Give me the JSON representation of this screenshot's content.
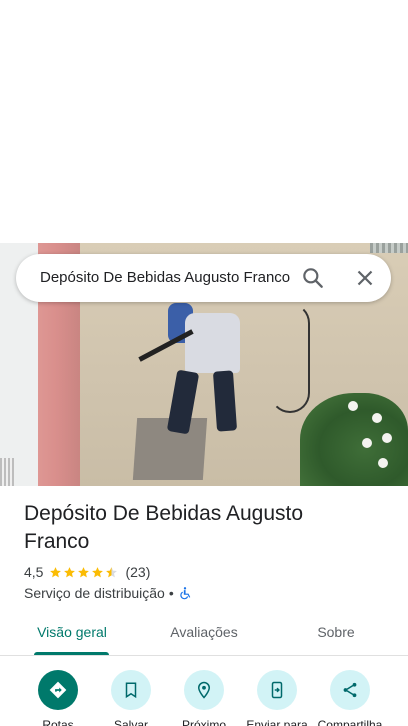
{
  "search": {
    "query": "Depósito De Bebidas Augusto Franco"
  },
  "place": {
    "title": "Depósito De Bebidas Augusto Franco",
    "rating_value": "4,5",
    "rating_stars": 4.5,
    "review_count": "(23)",
    "category": "Serviço de distribuição",
    "separator": "•"
  },
  "tabs": [
    {
      "label": "Visão geral",
      "active": true
    },
    {
      "label": "Avaliações",
      "active": false
    },
    {
      "label": "Sobre",
      "active": false
    }
  ],
  "actions": [
    {
      "label": "Rotas",
      "icon": "directions-icon"
    },
    {
      "label": "Salvar",
      "icon": "bookmark-icon"
    },
    {
      "label": "Próximo",
      "icon": "nearby-icon"
    },
    {
      "label": "Enviar para",
      "icon": "send-to-phone-icon"
    },
    {
      "label": "Compartilha",
      "icon": "share-icon"
    }
  ],
  "colors": {
    "accent": "#00796b",
    "action_bg": "#d2f3f6",
    "star": "#fbbc04",
    "accessible": "#1a73e8"
  }
}
